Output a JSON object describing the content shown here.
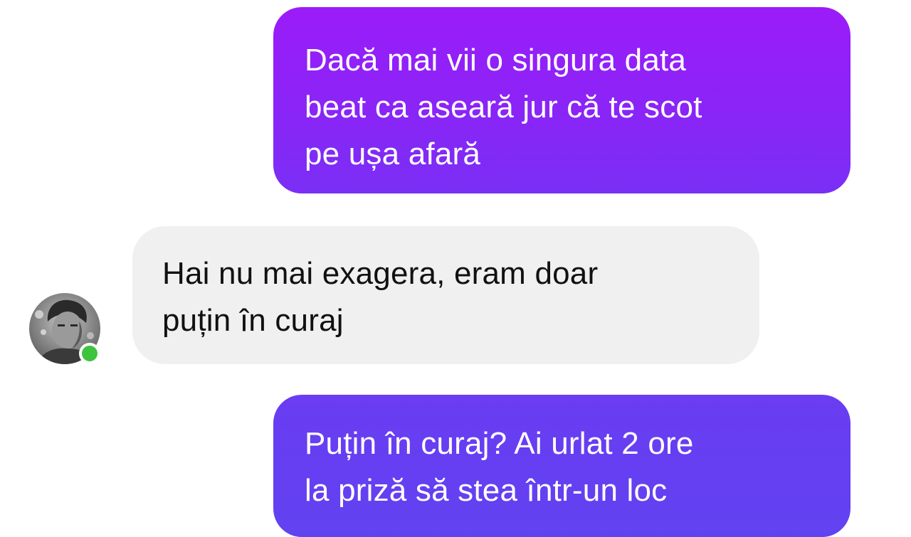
{
  "messages": [
    {
      "direction": "outgoing",
      "lines": [
        "Dacă mai vii o singura data",
        "beat ca aseară jur că te scot",
        "pe ușa afară"
      ]
    },
    {
      "direction": "incoming",
      "lines": [
        "Hai nu mai exagera, eram doar",
        "puțin în curaj"
      ]
    },
    {
      "direction": "outgoing",
      "lines": [
        "Puțin în curaj? Ai urlat 2 ore",
        "la priză să stea într-un loc"
      ]
    }
  ],
  "contact": {
    "presence": "online",
    "presence_color": "#3ec33e"
  },
  "colors": {
    "outgoing_bubble_top": "#9b1cf8",
    "outgoing_bubble_bottom": "#6142f1",
    "incoming_bubble": "#f0f0f0"
  }
}
